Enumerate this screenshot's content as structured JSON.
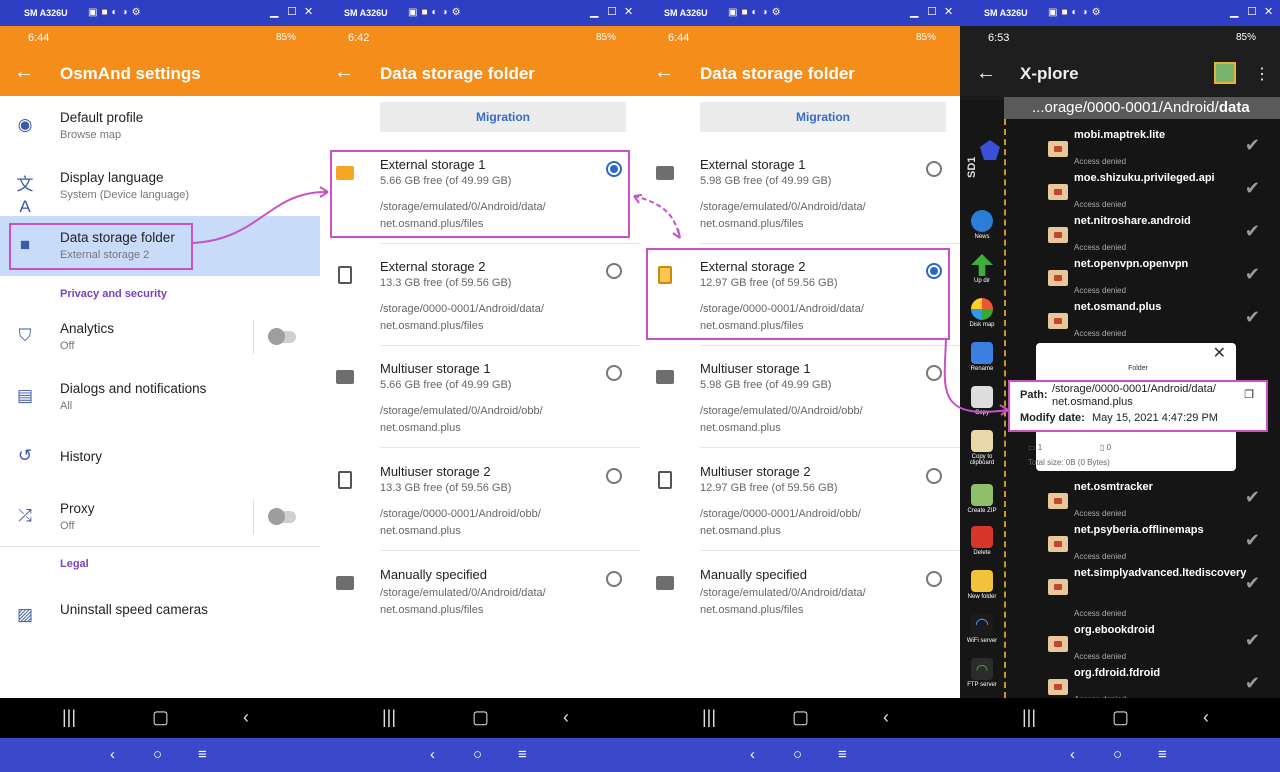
{
  "device_name": "SM A326U",
  "battery": "85%",
  "panel1": {
    "time": "6:44",
    "title": "OsmAnd settings",
    "items": [
      {
        "title": "Default profile",
        "sub": "Browse map"
      },
      {
        "title": "Display language",
        "sub": "System (Device language)"
      },
      {
        "title": "Data storage folder",
        "sub": "External storage 2"
      }
    ],
    "section_privacy": "Privacy and security",
    "items2": [
      {
        "title": "Analytics",
        "sub": "Off"
      },
      {
        "title": "Dialogs and notifications",
        "sub": "All"
      },
      {
        "title": "History",
        "sub": ""
      },
      {
        "title": "Proxy",
        "sub": "Off"
      }
    ],
    "section_legal": "Legal",
    "uninstall": "Uninstall speed cameras"
  },
  "panel2": {
    "time": "6:42",
    "title": "Data storage folder",
    "migration": "Migration",
    "options": [
      {
        "name": "External storage 1",
        "free": "5.66 GB free (of 49.99 GB)",
        "path1": "/storage/emulated/0/Android/data/",
        "path2": "net.osmand.plus/files",
        "selected": true
      },
      {
        "name": "External storage 2",
        "free": "13.3 GB free (of 59.56 GB)",
        "path1": "/storage/0000-0001/Android/data/",
        "path2": "net.osmand.plus/files",
        "selected": false
      },
      {
        "name": "Multiuser storage 1",
        "free": "5.66 GB free (of 49.99 GB)",
        "path1": "/storage/emulated/0/Android/obb/",
        "path2": "net.osmand.plus",
        "selected": false
      },
      {
        "name": "Multiuser storage 2",
        "free": "13.3 GB free (of 59.56 GB)",
        "path1": "/storage/0000-0001/Android/obb/",
        "path2": "net.osmand.plus",
        "selected": false
      },
      {
        "name": "Manually specified",
        "free": "",
        "path1": "/storage/emulated/0/Android/data/",
        "path2": "net.osmand.plus/files",
        "selected": false
      }
    ]
  },
  "panel3": {
    "time": "6:44",
    "title": "Data storage folder",
    "migration": "Migration",
    "options": [
      {
        "name": "External storage 1",
        "free": "5.98 GB free (of 49.99 GB)",
        "path1": "/storage/emulated/0/Android/data/",
        "path2": "net.osmand.plus/files",
        "selected": false
      },
      {
        "name": "External storage 2",
        "free": "12.97 GB free (of 59.56 GB)",
        "path1": "/storage/0000-0001/Android/data/",
        "path2": "net.osmand.plus/files",
        "selected": true
      },
      {
        "name": "Multiuser storage 1",
        "free": "5.98 GB free (of 49.99 GB)",
        "path1": "/storage/emulated/0/Android/obb/",
        "path2": "net.osmand.plus",
        "selected": false
      },
      {
        "name": "Multiuser storage 2",
        "free": "12.97 GB free (of 59.56 GB)",
        "path1": "/storage/0000-0001/Android/obb/",
        "path2": "net.osmand.plus",
        "selected": false
      },
      {
        "name": "Manually specified",
        "free": "",
        "path1": "/storage/emulated/0/Android/data/",
        "path2": "net.osmand.plus/files",
        "selected": false
      }
    ]
  },
  "panel4": {
    "time": "6:53",
    "title": "X-plore",
    "path_prefix": "...orage/0000-0001/Android/",
    "path_last": "data",
    "side_label": "SD1",
    "tools": [
      "News",
      "Up dir",
      "Disk map",
      "Rename",
      "Copy",
      "Copy to clipboard",
      "Create ZIP",
      "Delete",
      "New folder",
      "WiFi server",
      "FTP server"
    ],
    "rows_top": [
      "mobi.maptrek.lite",
      "moe.shizuku.privileged.api",
      "net.nitroshare.android",
      "net.openvpn.openvpn",
      "net.osmand.plus"
    ],
    "rows_bottom": [
      "net.osmtracker",
      "net.psyberia.offlinemaps",
      "net.simplyadvanced.ltediscovery",
      "org.ebookdroid",
      "org.fdroid.fdroid"
    ],
    "access_denied": "Access denied",
    "popup": {
      "tab": "Folder",
      "path_label": "Path:",
      "path1": "/storage/0000-0001/Android/data/",
      "path2": "net.osmand.plus",
      "modify_label": "Modify date:",
      "modify_value": "May 15, 2021 4:47:29 PM",
      "folders": "1",
      "files": "0",
      "total": "Total size: 0B (0 Bytes)"
    }
  }
}
